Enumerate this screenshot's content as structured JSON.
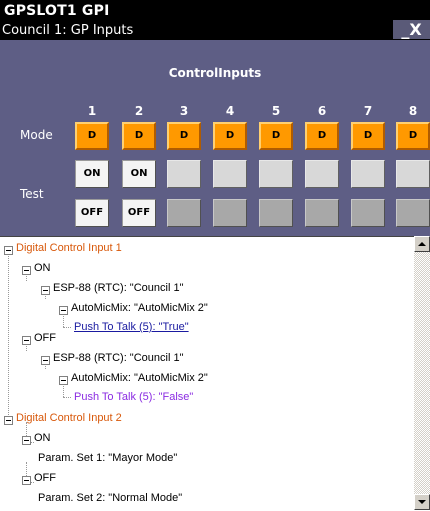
{
  "window": {
    "title": "GPSLOT1  GPI",
    "subtitle": "Council 1: GP Inputs",
    "controls_label": "_X"
  },
  "panel": {
    "header": "ControlInputs",
    "columns": [
      "1",
      "2",
      "3",
      "4",
      "5",
      "6",
      "7",
      "8"
    ],
    "mode_label": "Mode",
    "test_label": "Test",
    "mode_buttons": [
      "D",
      "D",
      "D",
      "D",
      "D",
      "D",
      "D",
      "D"
    ],
    "on_buttons": [
      "ON",
      "ON",
      "",
      "",
      "",
      "",
      "",
      ""
    ],
    "off_buttons": [
      "OFF",
      "OFF",
      "",
      "",
      "",
      "",
      "",
      ""
    ],
    "colors": {
      "panel_bg": "#5e5e85",
      "mode_button": "#ff9900",
      "title_bg": "#000000"
    }
  },
  "tree": {
    "nodes": [
      {
        "text": "Digital Control Input 1",
        "style": "orange"
      },
      {
        "text": "ON",
        "style": "black"
      },
      {
        "text": "ESP-88 (RTC): \"Council 1\"",
        "style": "black"
      },
      {
        "text": "AutoMicMix: \"AutoMicMix 2\"",
        "style": "black"
      },
      {
        "text": "Push To Talk (5): \"True\"",
        "style": "link"
      },
      {
        "text": "OFF",
        "style": "black"
      },
      {
        "text": "ESP-88 (RTC): \"Council 1\"",
        "style": "black"
      },
      {
        "text": "AutoMicMix: \"AutoMicMix 2\"",
        "style": "black"
      },
      {
        "text": "Push To Talk (5): \"False\"",
        "style": "purple"
      },
      {
        "text": "Digital Control Input 2",
        "style": "orange"
      },
      {
        "text": "ON",
        "style": "black"
      },
      {
        "text": "Param. Set 1: \"Mayor Mode\"",
        "style": "black"
      },
      {
        "text": "OFF",
        "style": "black"
      },
      {
        "text": "Param. Set 2: \"Normal Mode\"",
        "style": "black"
      }
    ]
  }
}
